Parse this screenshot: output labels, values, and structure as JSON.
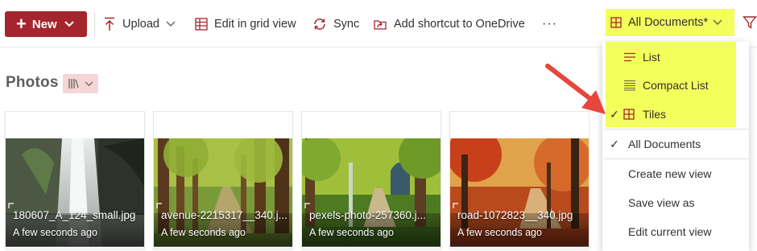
{
  "toolbar": {
    "new_label": "New",
    "upload_label": "Upload",
    "edit_grid_label": "Edit in grid view",
    "sync_label": "Sync",
    "shortcut_label": "Add shortcut to OneDrive",
    "more_label": "···",
    "view_selector_label": "All Documents*"
  },
  "library": {
    "title": "Photos"
  },
  "tiles": [
    {
      "name": "180607_A_124_small.jpg",
      "modified": "A few seconds ago"
    },
    {
      "name": "avenue-2215317__340.j...",
      "modified": "A few seconds ago"
    },
    {
      "name": "pexels-photo-257360.j...",
      "modified": "A few seconds ago"
    },
    {
      "name": "road-1072823__340.jpg",
      "modified": "A few seconds ago"
    }
  ],
  "view_menu": {
    "layouts": [
      {
        "label": "List",
        "icon": "list-icon",
        "checked": false
      },
      {
        "label": "Compact List",
        "icon": "compact-list-icon",
        "checked": false
      },
      {
        "label": "Tiles",
        "icon": "tiles-icon",
        "checked": true
      }
    ],
    "views": [
      {
        "label": "All Documents",
        "checked": true
      },
      {
        "label": "Create new view",
        "checked": false
      },
      {
        "label": "Save view as",
        "checked": false
      },
      {
        "label": "Edit current view",
        "checked": false
      }
    ],
    "check_glyph": "✓"
  },
  "colors": {
    "new_button": "#a4262c",
    "highlight": "#f3ff5a",
    "annotation_arrow": "#e8453c",
    "accent_icon": "#a4262c"
  }
}
